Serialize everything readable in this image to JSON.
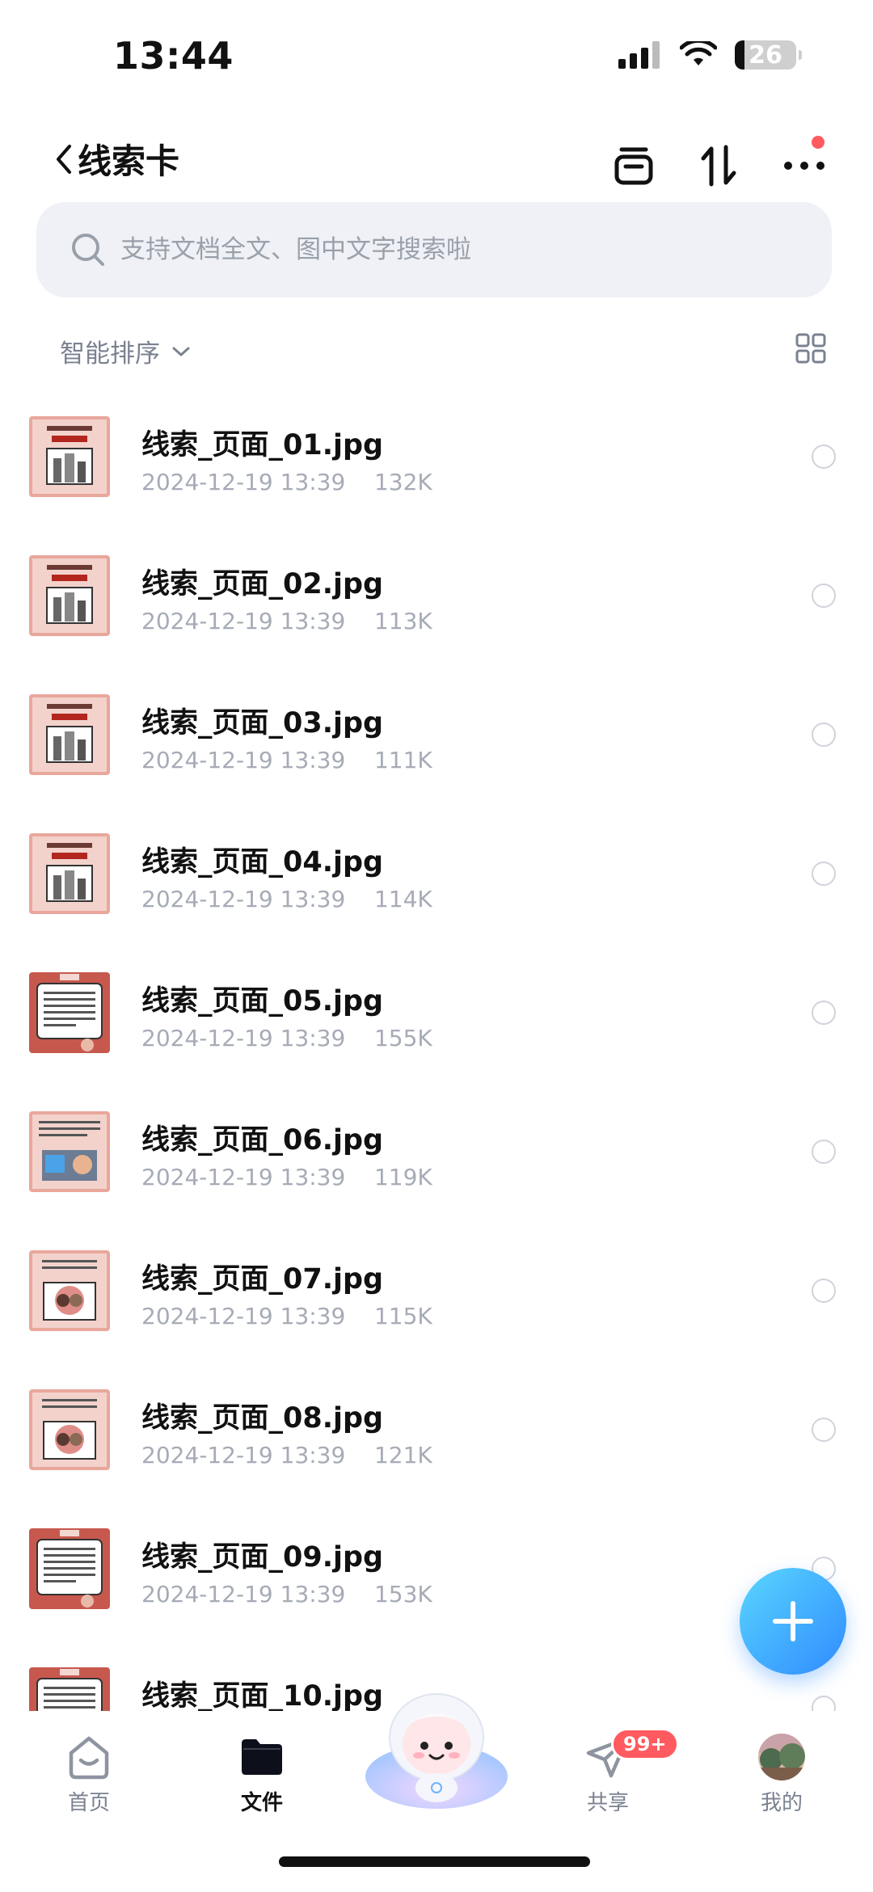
{
  "status_bar": {
    "time": "13:44",
    "battery": "26"
  },
  "header": {
    "title": "线索卡"
  },
  "search": {
    "placeholder": "支持文档全文、图中文字搜索啦"
  },
  "sort": {
    "label": "智能排序"
  },
  "files": [
    {
      "name": "线索_页面_01.jpg",
      "date": "2024-12-19 13:39",
      "size": "132K",
      "thumb": "a"
    },
    {
      "name": "线索_页面_02.jpg",
      "date": "2024-12-19 13:39",
      "size": "113K",
      "thumb": "a"
    },
    {
      "name": "线索_页面_03.jpg",
      "date": "2024-12-19 13:39",
      "size": "111K",
      "thumb": "a"
    },
    {
      "name": "线索_页面_04.jpg",
      "date": "2024-12-19 13:39",
      "size": "114K",
      "thumb": "a"
    },
    {
      "name": "线索_页面_05.jpg",
      "date": "2024-12-19 13:39",
      "size": "155K",
      "thumb": "b"
    },
    {
      "name": "线索_页面_06.jpg",
      "date": "2024-12-19 13:39",
      "size": "119K",
      "thumb": "c"
    },
    {
      "name": "线索_页面_07.jpg",
      "date": "2024-12-19 13:39",
      "size": "115K",
      "thumb": "d"
    },
    {
      "name": "线索_页面_08.jpg",
      "date": "2024-12-19 13:39",
      "size": "121K",
      "thumb": "d"
    },
    {
      "name": "线索_页面_09.jpg",
      "date": "2024-12-19 13:39",
      "size": "153K",
      "thumb": "b"
    },
    {
      "name": "线索_页面_10.jpg",
      "date": "",
      "size": "",
      "thumb": "b"
    }
  ],
  "tabs": [
    {
      "label": "首页",
      "icon": "home-icon"
    },
    {
      "label": "文件",
      "icon": "folder-icon",
      "active": true
    },
    {
      "label": "共享",
      "icon": "send-icon",
      "badge": "99+"
    },
    {
      "label": "我的",
      "icon": "avatar"
    }
  ],
  "colors": {
    "accent": "#2f8bff",
    "badge": "#ff5a5f",
    "thumb_pink": "#e9a79c"
  }
}
